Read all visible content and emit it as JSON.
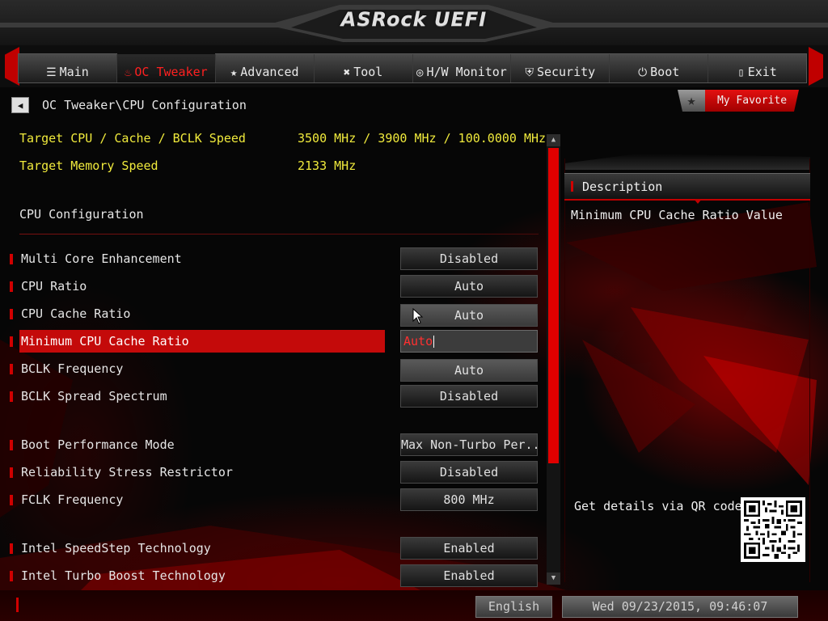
{
  "app": {
    "logo_text": "ASRock UEFI"
  },
  "tabs": [
    {
      "label": "Main",
      "icon": "list-icon",
      "glyph": "☰",
      "active": false
    },
    {
      "label": "OC Tweaker",
      "icon": "flame-icon",
      "glyph": "♨",
      "active": true
    },
    {
      "label": "Advanced",
      "icon": "star-icon",
      "glyph": "★",
      "active": false
    },
    {
      "label": "Tool",
      "icon": "tools-icon",
      "glyph": "✖",
      "active": false
    },
    {
      "label": "H/W Monitor",
      "icon": "monitor-icon",
      "glyph": "◎",
      "active": false
    },
    {
      "label": "Security",
      "icon": "shield-icon",
      "glyph": "⛨",
      "active": false
    },
    {
      "label": "Boot",
      "icon": "power-icon",
      "glyph": "⏻",
      "active": false
    },
    {
      "label": "Exit",
      "icon": "exit-door-icon",
      "glyph": "▯",
      "active": false
    }
  ],
  "breadcrumb": {
    "path": "OC Tweaker\\CPU Configuration",
    "back_icon": "back-arrow-icon"
  },
  "favorite": {
    "label": "My Favorite",
    "icon": "star-icon"
  },
  "info": {
    "target_cpu_label": "Target CPU / Cache / BCLK Speed",
    "target_cpu_value": "3500 MHz / 3900 MHz / 100.0000 MHz",
    "target_memory_label": "Target Memory Speed",
    "target_memory_value": "2133 MHz"
  },
  "section": {
    "title": "CPU Configuration"
  },
  "settings": [
    {
      "label": "Multi Core Enhancement",
      "value": "Disabled"
    },
    {
      "label": "CPU Ratio",
      "value": "Auto"
    },
    {
      "label": "CPU Cache Ratio",
      "value": "Auto"
    },
    {
      "label": "Minimum CPU Cache Ratio",
      "value": "Auto"
    },
    {
      "label": "BCLK Frequency",
      "value": "Auto"
    },
    {
      "label": "BCLK Spread Spectrum",
      "value": "Disabled"
    },
    {
      "label": "Boot Performance Mode",
      "value": "Max Non-Turbo Per..."
    },
    {
      "label": "Reliability Stress Restrictor",
      "value": "Disabled"
    },
    {
      "label": "FCLK Frequency",
      "value": "800 MHz"
    },
    {
      "label": "Intel SpeedStep Technology",
      "value": "Enabled"
    },
    {
      "label": "Intel Turbo Boost Technology",
      "value": "Enabled"
    }
  ],
  "description": {
    "title": "Description",
    "text": "Minimum CPU Cache Ratio Value",
    "qr_label": "Get details via QR code"
  },
  "status": {
    "language": "English",
    "datetime": "Wed 09/23/2015, 09:46:07"
  },
  "colors": {
    "accent": "#d00000",
    "info_text": "#f0ea3c",
    "selected_row": "#c40a0a"
  }
}
